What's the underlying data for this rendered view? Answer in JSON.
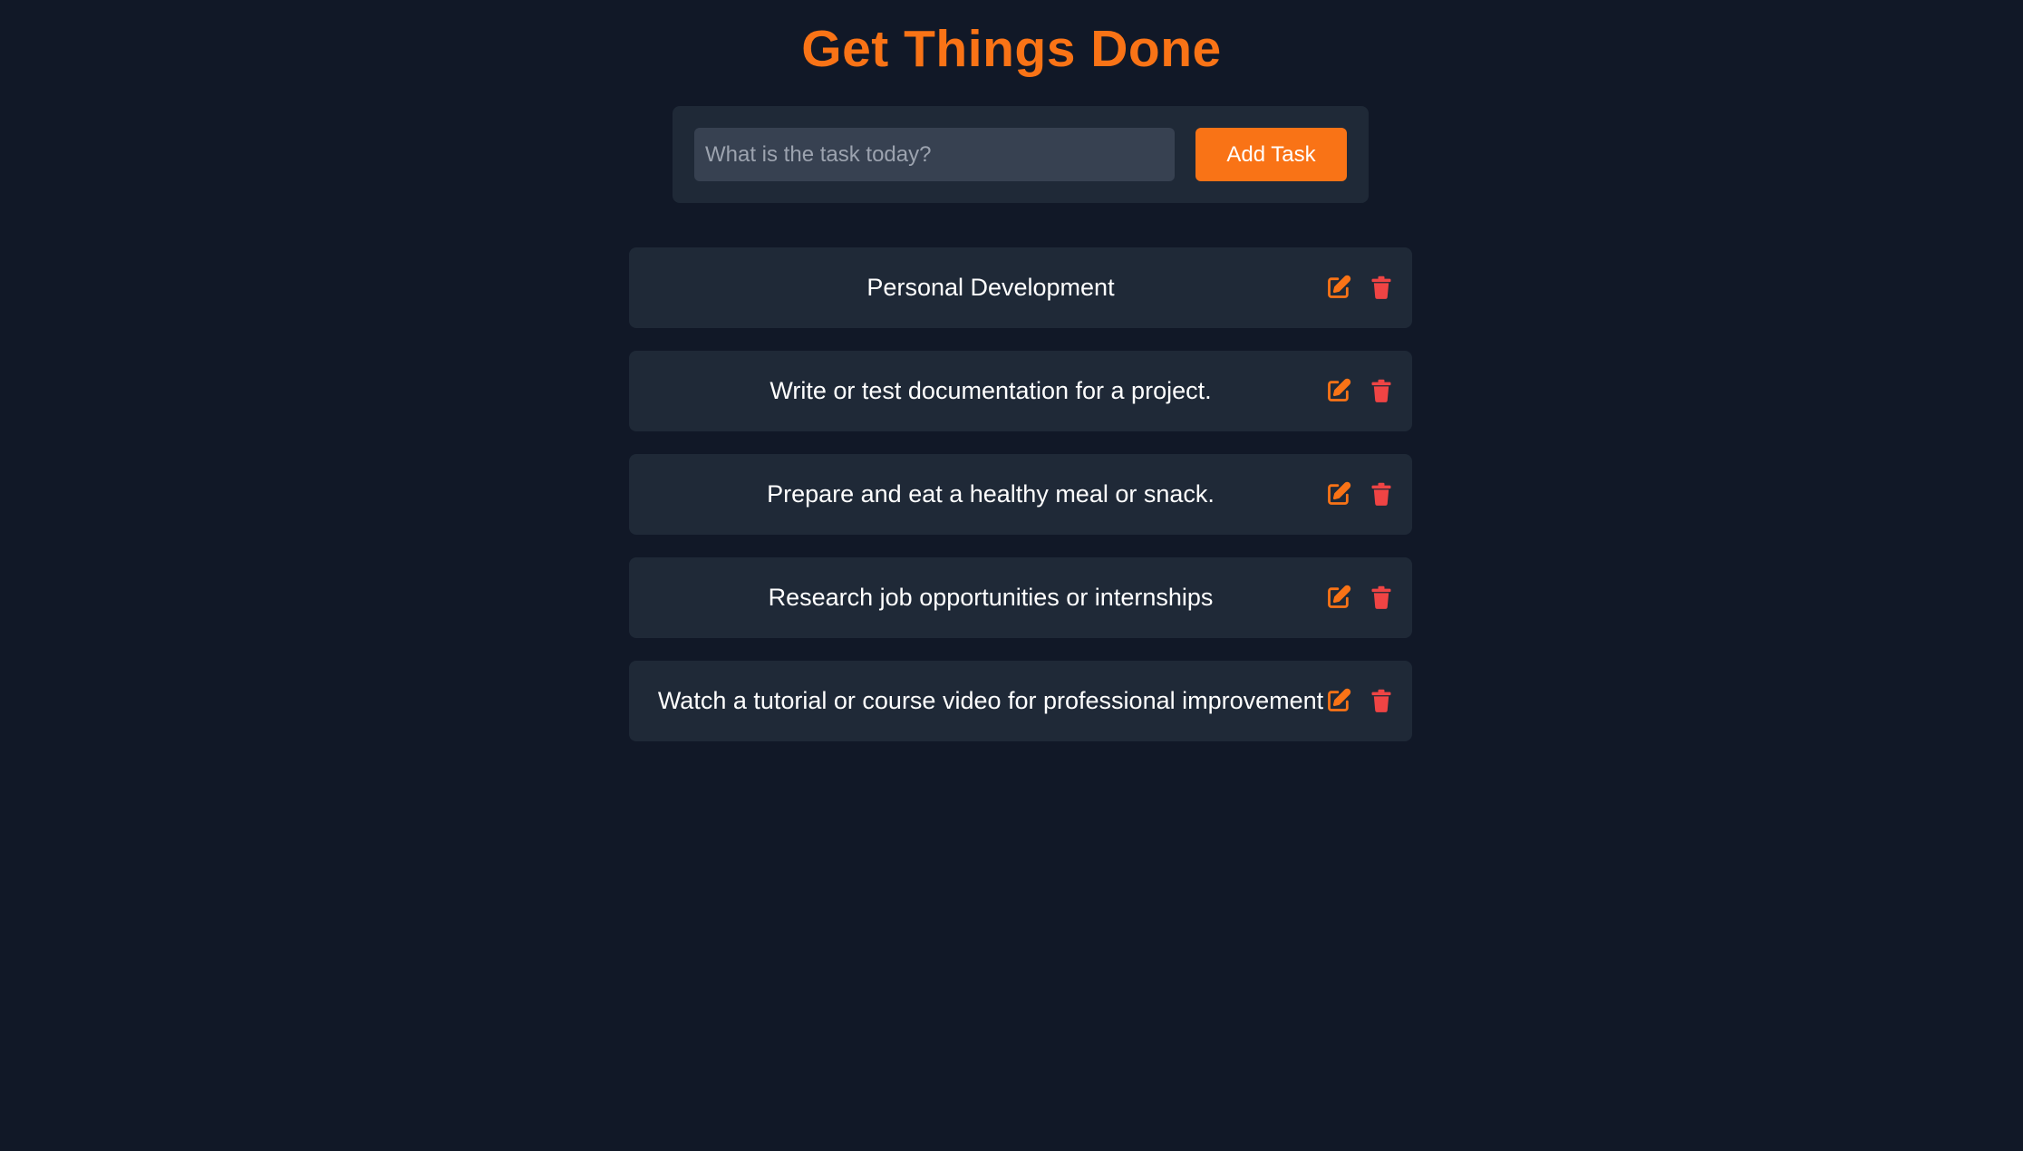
{
  "app": {
    "title": "Get Things Done"
  },
  "form": {
    "placeholder": "What is the task today?",
    "value": "",
    "add_label": "Add Task"
  },
  "tasks": [
    {
      "text": "Personal Development"
    },
    {
      "text": "Write or test documentation for a project."
    },
    {
      "text": "Prepare and eat a healthy meal or snack."
    },
    {
      "text": "Research job opportunities or internships"
    },
    {
      "text": "Watch a tutorial or course video for professional improvement"
    }
  ],
  "icons": {
    "edit": "edit-icon",
    "delete": "trash-icon"
  },
  "colors": {
    "background": "#111827",
    "panel": "#1f2937",
    "input": "#374151",
    "accent": "#f97316",
    "delete": "#ef4444",
    "text": "#ffffff",
    "placeholder": "#9ca3af"
  }
}
